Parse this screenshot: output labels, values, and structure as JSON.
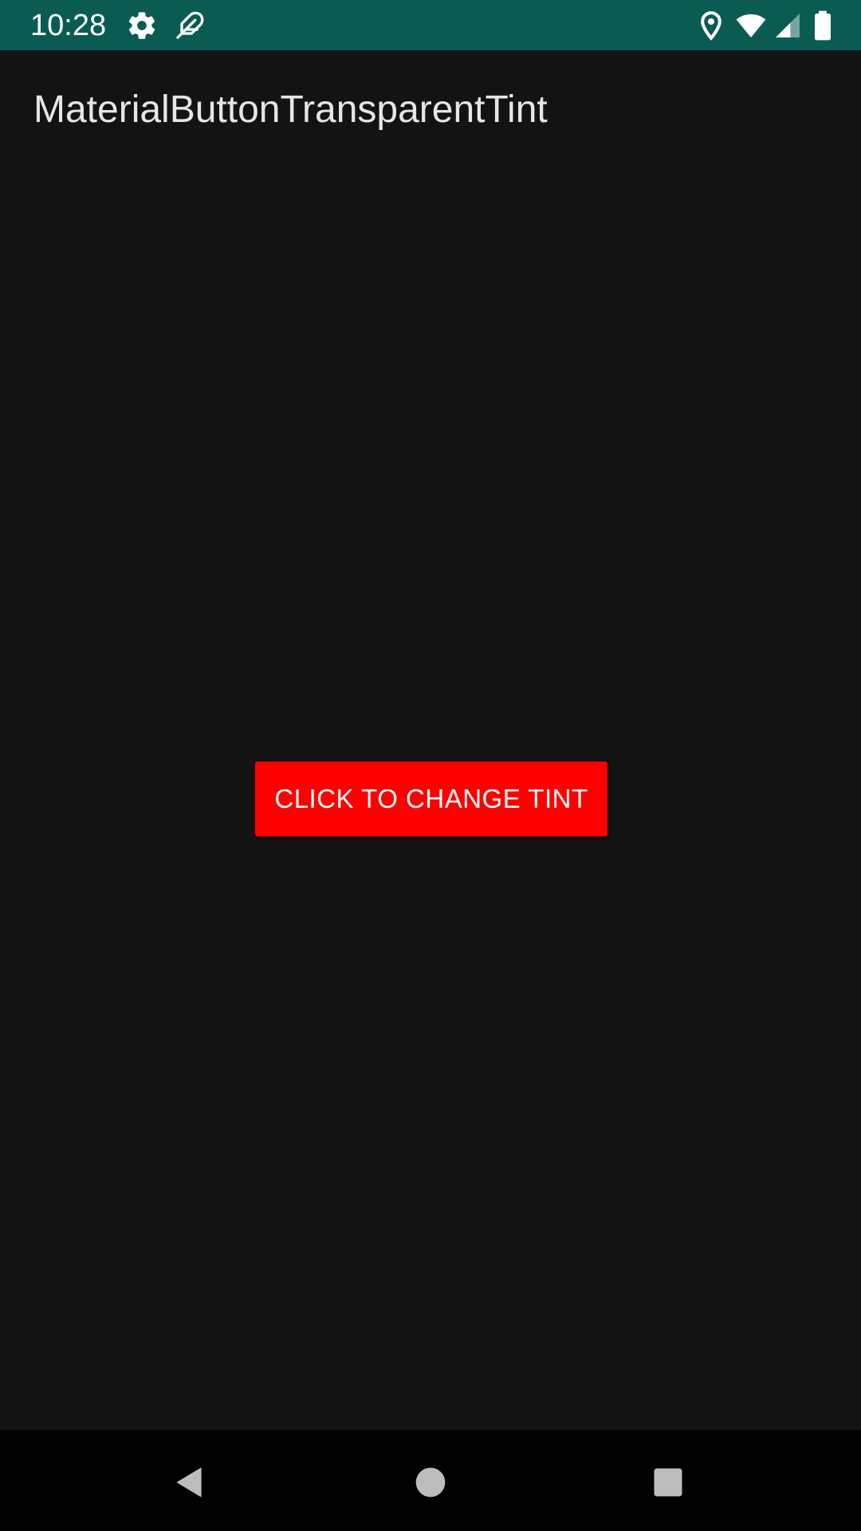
{
  "status_bar": {
    "time": "10:28",
    "background_color": "#0a5c52",
    "left_icons": [
      "gear-icon",
      "feather-icon"
    ],
    "right_icons": [
      "location-icon",
      "wifi-icon",
      "signal-icon",
      "battery-icon"
    ]
  },
  "app": {
    "title": "MaterialButtonTransparentTint",
    "background_color": "#141314"
  },
  "button": {
    "label": "CLICK TO CHANGE TINT",
    "tint_color": "#ff0000"
  },
  "nav_bar": {
    "items": [
      "back-icon",
      "home-icon",
      "recents-icon"
    ]
  }
}
